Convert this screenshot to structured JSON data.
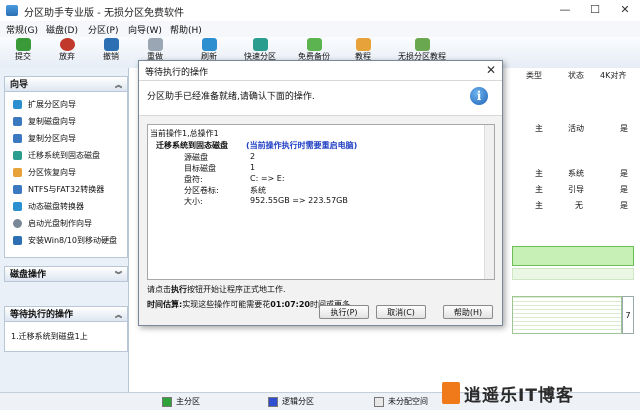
{
  "app": {
    "title": "分区助手专业版 - 无损分区免费软件"
  },
  "window_controls": [
    "—",
    "☐",
    "✕"
  ],
  "menu": [
    "常规(G)",
    "磁盘(D)",
    "分区(P)",
    "向导(W)",
    "帮助(H)"
  ],
  "toolbar": {
    "items": [
      {
        "label": "提交"
      },
      {
        "label": "放弃"
      },
      {
        "label": "撤销"
      },
      {
        "label": "重做"
      },
      {
        "label": "刷新"
      },
      {
        "label": "快速分区"
      },
      {
        "label": "免费备份"
      },
      {
        "label": "教程"
      },
      {
        "label": "无损分区教程"
      }
    ]
  },
  "sidebar": {
    "wizard_title": "向导",
    "wizard_items": [
      {
        "label": "扩展分区向导"
      },
      {
        "label": "复制磁盘向导"
      },
      {
        "label": "复制分区向导"
      },
      {
        "label": "迁移系统到固态磁盘"
      },
      {
        "label": "分区恢复向导"
      },
      {
        "label": "NTFS与FAT32转换器"
      },
      {
        "label": "动态磁盘转换器"
      },
      {
        "label": "启动光盘制作向导"
      },
      {
        "label": "安装Win8/10到移动硬盘"
      }
    ],
    "disk_ops_title": "磁盘操作",
    "pending_title": "等待执行的操作",
    "pending_items": [
      "1.迁移系统到磁盘1上"
    ]
  },
  "table": {
    "columns": [
      "类型",
      "状态",
      "4K对齐"
    ],
    "rows": [
      {
        "type": "主",
        "status": "活动",
        "align": "是"
      },
      {
        "type": "主",
        "status": "系统",
        "align": "是"
      },
      {
        "type": "主",
        "status": "引导",
        "align": "是"
      },
      {
        "type": "主",
        "status": "无",
        "align": "是"
      }
    ],
    "disk_num": "7"
  },
  "dialog": {
    "title": "等待执行的操作",
    "close": "✕",
    "header": "分区助手已经准备就绪,请确认下面的操作.",
    "ops": {
      "line1": "当前操作1,总操作1",
      "op_title": "迁移系统到固态磁盘",
      "op_note": "(当前操作执行时需要重启电脑)",
      "details": [
        {
          "key": "源磁盘",
          "value": "2"
        },
        {
          "key": "目标磁盘",
          "value": "1"
        },
        {
          "key": "盘符:",
          "value": "C: => E:"
        },
        {
          "key": "分区卷标:",
          "value": "系统"
        },
        {
          "key": "大小:",
          "value": "952.55GB => 223.57GB"
        }
      ]
    },
    "hint_prefix": "请点击",
    "hint_bold": "执行",
    "hint_suffix": "按钮开始让程序正式地工作.",
    "time_label": "时间估算:",
    "time_prefix": "实现这些操作可能需要花",
    "time_value": "01:07:20",
    "time_suffix": "时间或更多.",
    "buttons": {
      "execute": "执行(P)",
      "cancel": "取消(C)",
      "help": "帮助(H)"
    }
  },
  "status": {
    "legend": [
      {
        "label": "主分区",
        "color": "#2fa33a"
      },
      {
        "label": "逻辑分区",
        "color": "#2f4fd0"
      },
      {
        "label": "未分配空间",
        "color": "#e8e8e8"
      }
    ]
  },
  "watermark": {
    "text": "逍遥乐IT博客"
  },
  "colors": {
    "accent": "#2c6fb3",
    "disk_green": "#c6f0b6",
    "title_blue": "#1f3fc4"
  }
}
